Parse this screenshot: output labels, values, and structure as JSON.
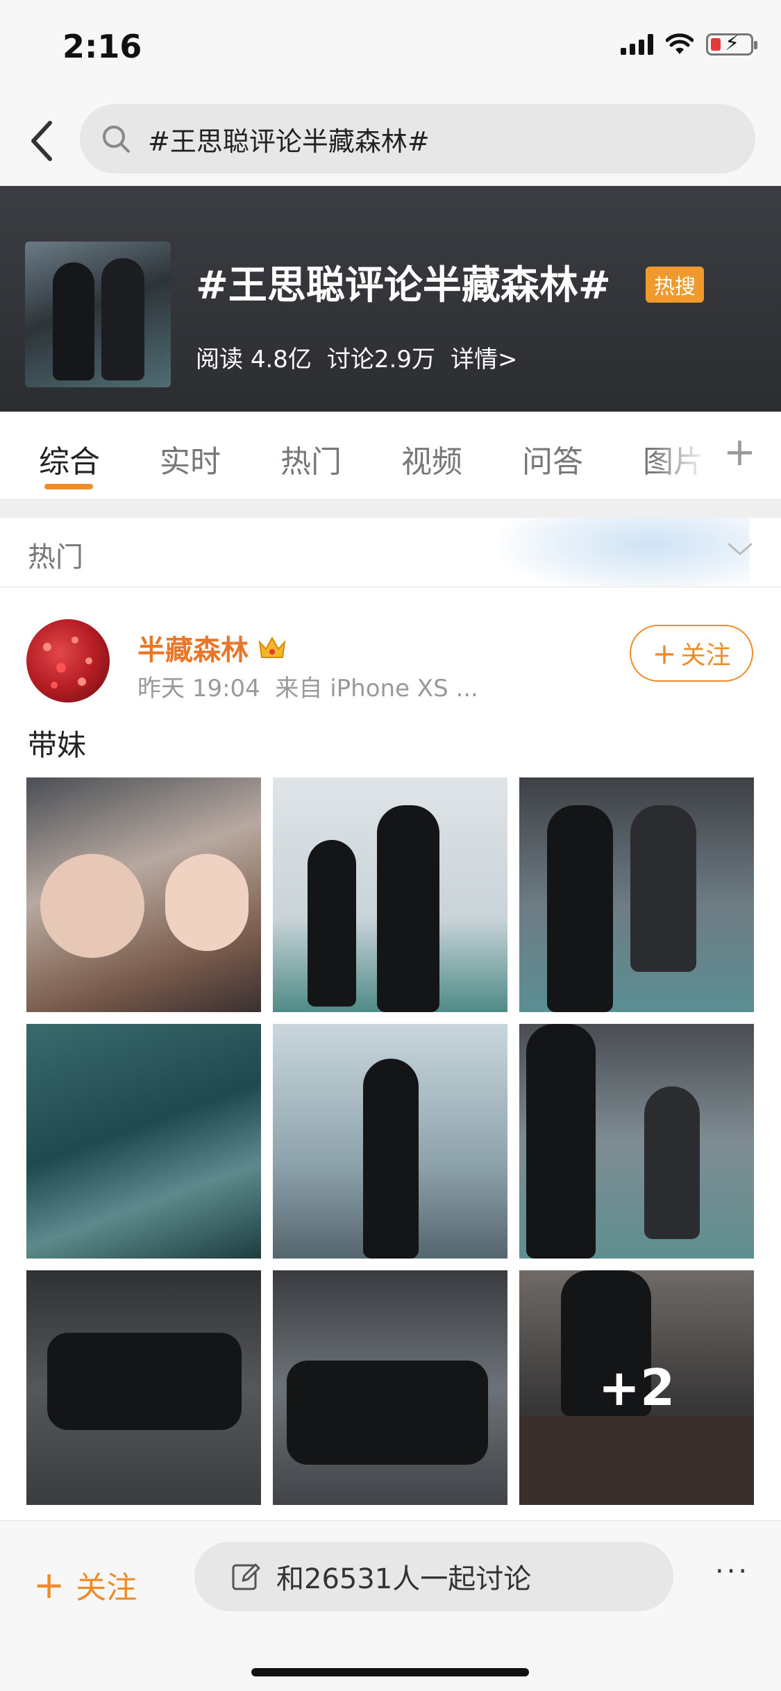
{
  "status_bar": {
    "time": "2:16"
  },
  "search": {
    "query": "#王思聪评论半藏森林#"
  },
  "topic": {
    "title": "#王思聪评论半藏森林#",
    "badge": "热搜",
    "read_label": "阅读",
    "read_value": "4.8亿",
    "discuss_label": "讨论",
    "discuss_value": "2.9万",
    "details_link": "详情>"
  },
  "tabs": [
    {
      "label": "综合",
      "active": true
    },
    {
      "label": "实时",
      "active": false
    },
    {
      "label": "热门",
      "active": false
    },
    {
      "label": "视频",
      "active": false
    },
    {
      "label": "问答",
      "active": false
    },
    {
      "label": "图片",
      "active": false
    }
  ],
  "section": {
    "label": "热门"
  },
  "post": {
    "author": "半藏森林",
    "time": "昨天 19:04",
    "source": "来自 iPhone XS ...",
    "follow_label": "关注",
    "text": "带妹",
    "more_images": "+2"
  },
  "bottom_bar": {
    "follow_label": "关注",
    "discuss_placeholder": "和26531人一起讨论",
    "more": "···"
  },
  "colors": {
    "accent": "#f08c28",
    "banner": "#35373b",
    "hot_badge": "#f09a2e"
  }
}
